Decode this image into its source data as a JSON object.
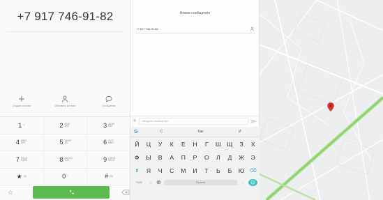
{
  "dialer": {
    "number": "+7 917 746-91-82",
    "actions": [
      {
        "icon": "plus-icon",
        "label": "Создать контакт"
      },
      {
        "icon": "person-icon",
        "label": "Обновить контакт"
      },
      {
        "icon": "message-bubble-icon",
        "label": "Сообщение"
      }
    ],
    "keys": [
      {
        "digit": "1",
        "letters": "∞"
      },
      {
        "digit": "2",
        "letters": "АБВГ ABC"
      },
      {
        "digit": "3",
        "letters": "ДЕЖЗ DEF"
      },
      {
        "digit": "4",
        "letters": "ИЙКЛ GHI"
      },
      {
        "digit": "5",
        "letters": "МНОП JKL"
      },
      {
        "digit": "6",
        "letters": "РСТУ MNO"
      },
      {
        "digit": "7",
        "letters": "ФХЦЧ PQRS"
      },
      {
        "digit": "8",
        "letters": "ШЩЪЫ TUV"
      },
      {
        "digit": "9",
        "letters": "ЬЭЮЯ WXYZ"
      },
      {
        "digit": "★",
        "letters": "(P)"
      },
      {
        "digit": "0",
        "letters": "+"
      },
      {
        "digit": "#",
        "letters": "(W)"
      }
    ]
  },
  "message": {
    "title": "Новое сообщение",
    "recipient": "+7 917 746-91-82",
    "input_placeholder": "Введите сообщение"
  },
  "keyboard": {
    "suggestions": [
      "С",
      "Как",
      "И"
    ],
    "rows": [
      [
        "Й",
        "Ц",
        "У",
        "К",
        "Е",
        "Н",
        "Г",
        "Ш",
        "Щ",
        "З",
        "Х"
      ],
      [
        "Ф",
        "Ы",
        "В",
        "А",
        "П",
        "Р",
        "О",
        "Л",
        "Д",
        "Ж",
        "Э"
      ],
      [
        "⬆",
        "Я",
        "Ч",
        "С",
        "М",
        "И",
        "Т",
        "Ь",
        "Б",
        "Ю",
        "⌫"
      ]
    ],
    "sym_label": "?123",
    "comma": ",",
    "period": ".",
    "space_label": "Русский"
  },
  "colors": {
    "call_green": "#5bbb4f",
    "accent_teal": "#3fc0c0",
    "map_pin": "#d93434"
  }
}
